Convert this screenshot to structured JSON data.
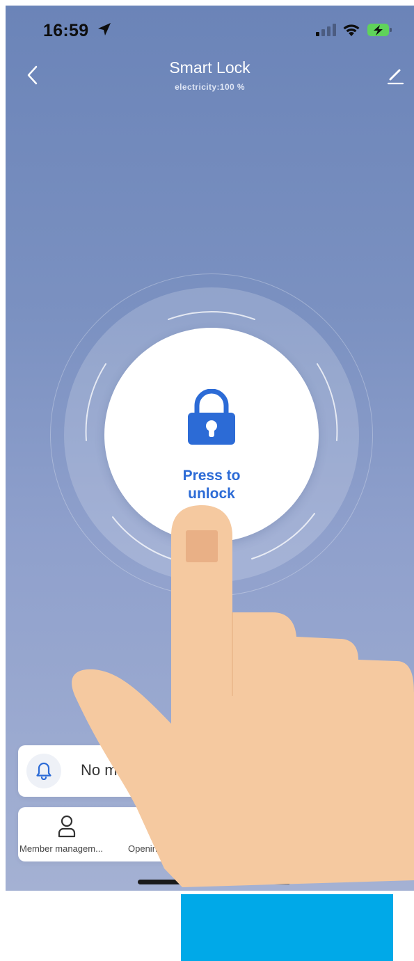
{
  "status_bar": {
    "time": "16:59",
    "location_icon": "location-arrow-icon",
    "signal_icon": "cellular-signal-icon",
    "wifi_icon": "wifi-icon",
    "battery_icon": "battery-charging-icon"
  },
  "header": {
    "back_icon": "chevron-left-icon",
    "title": "Smart Lock",
    "subtitle": "electricity:100 %",
    "edit_icon": "pencil-icon"
  },
  "unlock": {
    "label_line1": "Press to",
    "label_line2": "unlock",
    "icon": "padlock-icon",
    "accent_color": "#2c6bd6"
  },
  "message_card": {
    "icon": "bell-icon",
    "text": "No m"
  },
  "menu": {
    "items": [
      {
        "label": "Member managem...",
        "icon": "person-icon"
      },
      {
        "label": "Opening",
        "icon": ""
      }
    ]
  },
  "overlay": {
    "hand_icon": "pointing-hand-illustration",
    "sleeve_color": "#00a9e8",
    "skin_color": "#f5c9a0"
  }
}
